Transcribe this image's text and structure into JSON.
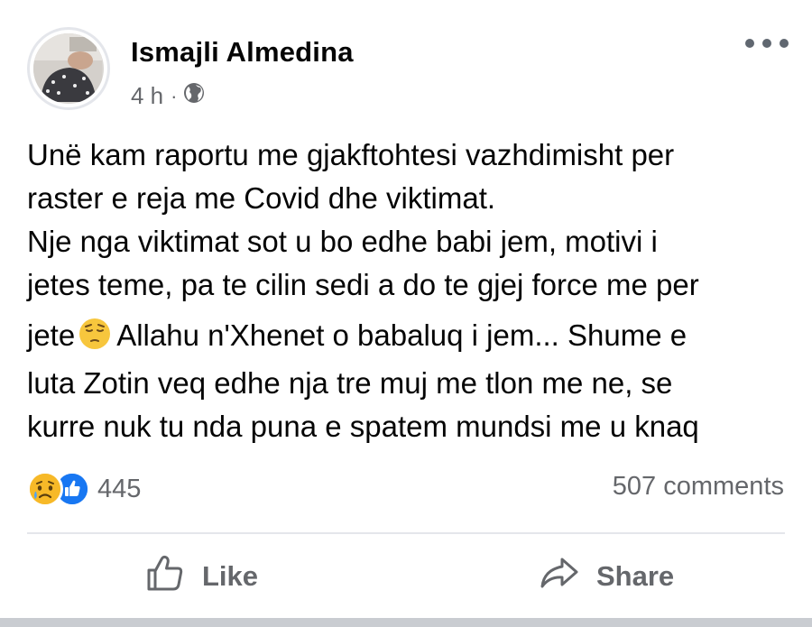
{
  "post": {
    "author": "Ismajli Almedina",
    "time": "4 h",
    "separator": "·",
    "privacy_icon": "globe-icon",
    "more_icon": "more-options-icon",
    "text_lines": [
      "Unë kam raportu me gjakftohtesi vazhdimisht per",
      "raster e reja me Covid dhe viktimat.",
      "Nje nga viktimat sot u bo edhe babi jem, motivi i",
      "jetes teme, pa te cilin sedi a do te gjej force me per"
    ],
    "line5_before": "jete",
    "line5_emoji": "pensive-face-emoji",
    "line5_after": "Allahu n'Xhenet o babaluq i jem... Shume e",
    "text_lines_end": [
      "luta Zotin veq edhe nja tre muj me tlon me ne, se",
      "kurre nuk tu nda puna e spatem mundsi me u knaq"
    ]
  },
  "reactions": {
    "icons": [
      "sad-reaction-icon",
      "like-reaction-icon"
    ],
    "count": "445"
  },
  "comments": {
    "count_text": "507 comments"
  },
  "actions": {
    "like_label": "Like",
    "share_label": "Share"
  },
  "colors": {
    "like_blue": "#1877f2",
    "sad_yellow": "#f7b928",
    "secondary_text": "#65676b"
  }
}
